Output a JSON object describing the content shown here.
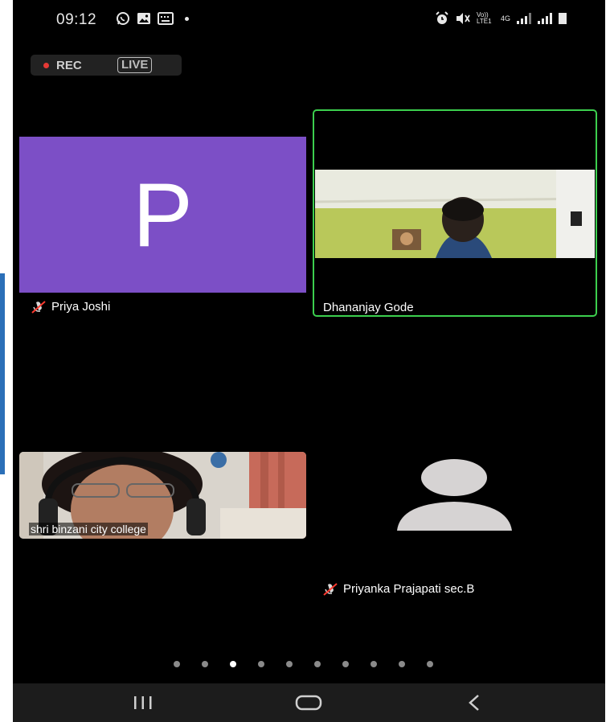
{
  "status_bar": {
    "time": "09:12",
    "left_icons": [
      "whatsapp-icon",
      "gallery-icon",
      "keyboard-icon",
      "dot-icon"
    ],
    "right_icons": [
      "alarm-icon",
      "mute-icon",
      "volte-icon",
      "network-4g-icon",
      "signal-icon",
      "signal-icon",
      "battery-icon"
    ],
    "volte_label": "Vo)) LTE1",
    "network_label": "4G"
  },
  "recording": {
    "rec_label": "REC",
    "live_label": "LIVE"
  },
  "participants": [
    {
      "name": "Priya Joshi",
      "avatar_letter": "P",
      "avatar_color": "#7c4fc6",
      "muted": true
    },
    {
      "name": "Dhananjay Gode",
      "active_speaker": true,
      "highlight_color": "#3ccf4e",
      "muted": false
    },
    {
      "name": "shri binzani city college",
      "video_on": true,
      "muted": false
    },
    {
      "name": "Priyanka Prajapati sec.B",
      "muted": true
    }
  ],
  "pagination": {
    "total_pages": 10,
    "current_page": 3
  },
  "nav": {
    "recents": "recents-icon",
    "home": "home-icon",
    "back": "back-icon"
  }
}
